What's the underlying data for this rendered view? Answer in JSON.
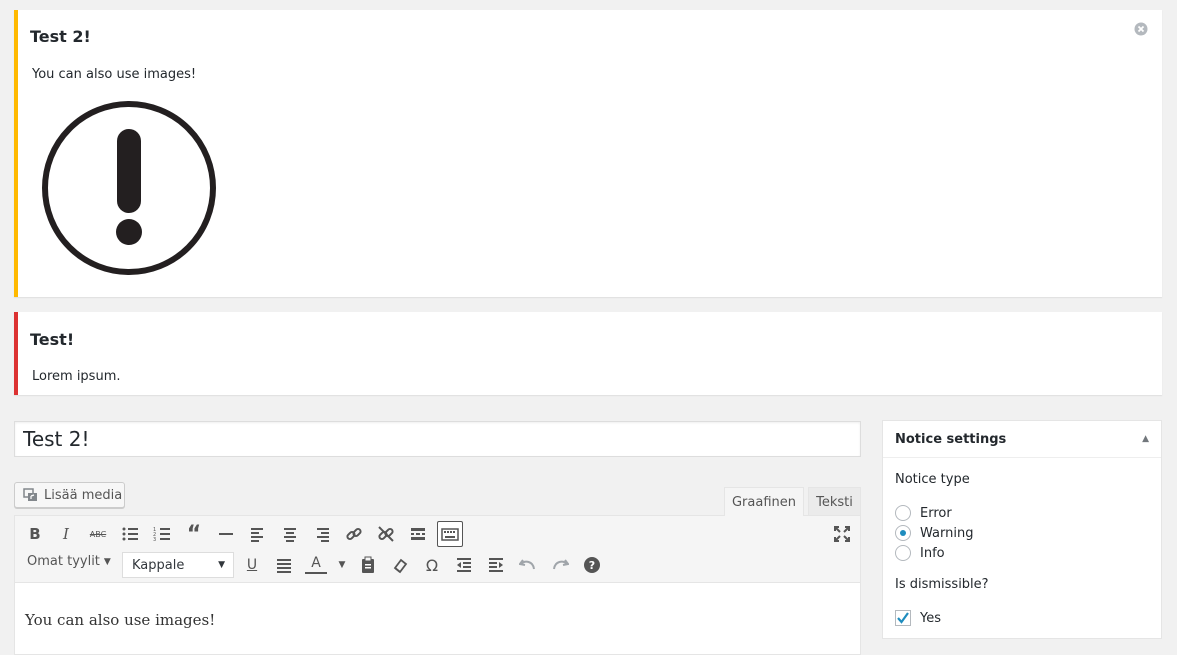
{
  "notices": [
    {
      "title": "Test 2!",
      "body": "You can also use images!",
      "type": "warning",
      "color": "#ffb900"
    },
    {
      "title": "Test!",
      "body": "Lorem ipsum.",
      "type": "error",
      "color": "#dc3232"
    }
  ],
  "editor": {
    "title_value": "Test 2!",
    "add_media_label": "Lisää media",
    "tabs": [
      "Graafinen",
      "Teksti"
    ],
    "styles_label": "Omat tyylit",
    "format_select": "Kappale",
    "content_text": "You can also use images!"
  },
  "notice_settings": {
    "title": "Notice settings",
    "type_label": "Notice type",
    "options": [
      "Error",
      "Warning",
      "Info"
    ],
    "selected": "Warning",
    "dismissible_label": "Is dismissible?",
    "dismissible_option": "Yes"
  },
  "colors": {
    "accent": "#1e8cbe",
    "warning": "#ffb900",
    "error": "#dc3232"
  }
}
